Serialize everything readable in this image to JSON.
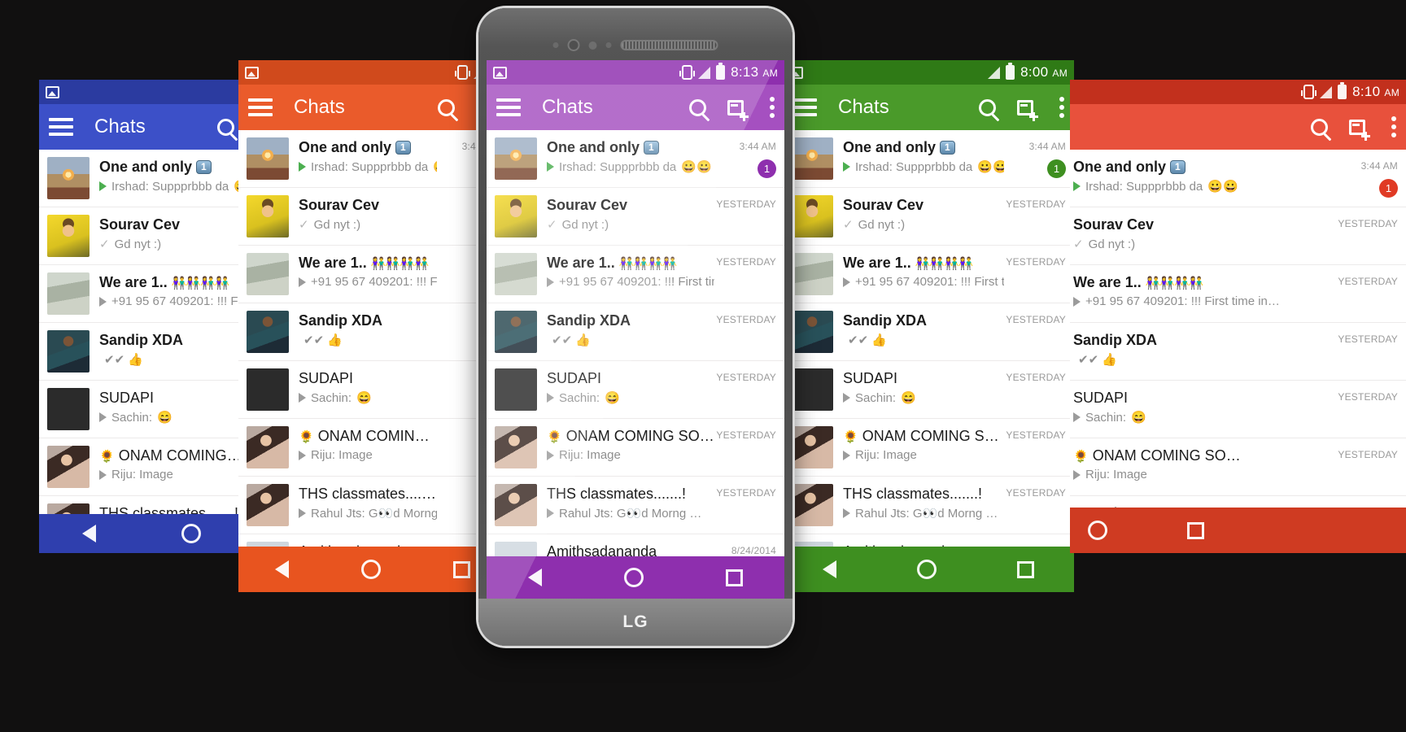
{
  "app": {
    "title": "Chats",
    "icons": {
      "menu": "hamburger-menu-icon",
      "search": "search-icon",
      "new_chat": "new-chat-icon",
      "overflow": "kebab-menu-icon",
      "status_image": "image-notification-icon",
      "vibrate": "vibrate-icon",
      "signal": "signal-icon",
      "battery": "battery-icon",
      "nav_back": "nav-back-icon",
      "nav_home": "nav-home-icon",
      "nav_recents": "nav-recents-icon"
    }
  },
  "device": {
    "brand": "LG",
    "speaker": "earpiece-speaker"
  },
  "themes": {
    "blue": {
      "accent": "#3c50c8",
      "status": "#2b3ba0",
      "nav": "#2f3fae",
      "badge": "#3c50c8"
    },
    "orange": {
      "accent": "#ea5b2b",
      "status": "#d04a1c",
      "nav": "#e8541f",
      "badge": "#ea5b2b"
    },
    "purple": {
      "accent": "#a550c0",
      "status": "#8e2fae",
      "nav": "#8e2fae",
      "badge": "#8e2fae"
    },
    "green": {
      "accent": "#4a9a2a",
      "status": "#2f7a16",
      "nav": "#3e8f20",
      "badge": "#3e8f20"
    },
    "red": {
      "accent": "#e8513c",
      "status": "#c2301d",
      "nav": "#cf3b22",
      "badge": "#e03a24"
    }
  },
  "phones": [
    {
      "id": "blue",
      "theme": "blue",
      "time": "",
      "timestamps_label": "hidden"
    },
    {
      "id": "orange",
      "theme": "orange",
      "time": "",
      "timestamps_label": "YESTERDAY"
    },
    {
      "id": "purple",
      "theme": "purple",
      "time": "8:13 AM",
      "timestamps_label": "YESTERDAY"
    },
    {
      "id": "green",
      "theme": "green",
      "time": "8:00 AM",
      "timestamps_label": "YESTERDAY"
    },
    {
      "id": "red",
      "theme": "red",
      "time": "8:10 AM",
      "timestamps_label": "YESTERDAY"
    }
  ],
  "chats": [
    {
      "name": "One and only",
      "name_bold": true,
      "name_badge": "1",
      "preview": "Irshad: Suppprbbb da",
      "preview_emoji": "😀😀",
      "marker": "play-green",
      "time": "3:44 AM",
      "unread": "1",
      "avatar": "a-sun"
    },
    {
      "name": "Sourav Cev",
      "name_bold": true,
      "name_badge": "",
      "preview": "Gd nyt :)",
      "preview_emoji": "",
      "marker": "check",
      "time": "YESTERDAY",
      "unread": "",
      "avatar": "a-yellow"
    },
    {
      "name": "We are 1..",
      "name_bold": true,
      "name_badge": "",
      "name_emoji": "👫👫👫👫",
      "preview": "+91 95 67 409201: !!! First time in…",
      "preview_emoji": "",
      "marker": "play-grey",
      "time": "YESTERDAY",
      "unread": "",
      "avatar": "a-road"
    },
    {
      "name": "Sandip XDA",
      "name_bold": true,
      "name_badge": "",
      "preview": "",
      "preview_emoji": "✔✔ 👍",
      "marker": "none",
      "time": "YESTERDAY",
      "unread": "",
      "avatar": "a-man"
    },
    {
      "name": "SUDAPI",
      "name_bold": false,
      "name_badge": "",
      "preview": "Sachin:",
      "preview_emoji": "😄",
      "marker": "play-grey",
      "time": "YESTERDAY",
      "unread": "",
      "avatar": "a-black"
    },
    {
      "name": "ONAM COMING SO…",
      "name_bold": false,
      "name_badge": "",
      "name_prefix_emoji": "🌻",
      "preview": "Riju: Image",
      "preview_emoji": "",
      "marker": "play-grey",
      "time": "YESTERDAY",
      "unread": "",
      "avatar": "a-lady"
    },
    {
      "name": "THS classmates.......!",
      "name_bold": false,
      "name_badge": "",
      "preview": "Rahul Jts: G👀d  Morng …",
      "preview_emoji": "",
      "marker": "play-grey",
      "time": "YESTERDAY",
      "unread": "",
      "avatar": "a-lady"
    },
    {
      "name": "Amithsadananda",
      "name_bold": false,
      "name_badge": "",
      "preview": "",
      "preview_emoji": "",
      "marker": "none",
      "time": "8/24/2014",
      "unread": "",
      "avatar": "a-palace"
    }
  ]
}
